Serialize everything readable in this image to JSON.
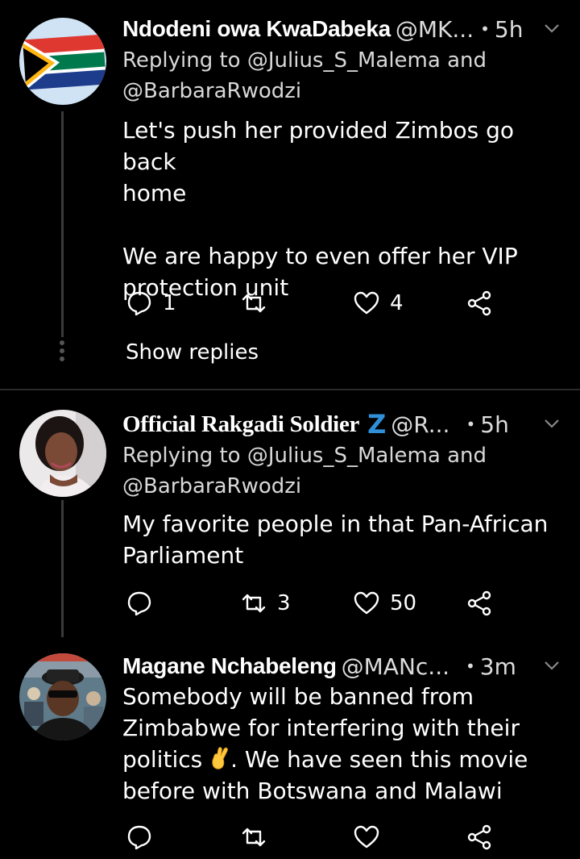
{
  "tweets": [
    {
      "name": "Ndodeni owa KwaDabeka",
      "handle": "@MK...",
      "dot": "•",
      "time": "5h",
      "reply_prefix": "Replying to @Julius_S_Malema and",
      "reply_second": "@BarbaraRwodzi",
      "text": "Let's push her provided Zimbos go back\nhome\n\nWe are happy to even offer her VIP\nprotection unit",
      "reply_count": "1",
      "retweet_count": "",
      "like_count": "4",
      "show_replies": "Show replies",
      "avatar_icon": "south-africa-flag"
    },
    {
      "name": "Official Rakgadi Soldier",
      "badge": "Z",
      "handle": "@R...",
      "dot": "•",
      "time": "5h",
      "reply_prefix": "Replying to @Julius_S_Malema and",
      "reply_second": "@BarbaraRwodzi",
      "text": "My favorite people in that Pan-African\nParliament",
      "reply_count": "",
      "retweet_count": "3",
      "like_count": "50",
      "avatar_icon": "profile-photo"
    },
    {
      "name": "Magane Nchabeleng",
      "handle": "@MANc...",
      "dot": "•",
      "time": "3m",
      "text_part1": "Somebody will be banned from\nZimbabwe for interfering with their\npolitics ",
      "text_part2": ". We have seen this movie\nbefore with Botswana and Malawi",
      "emoji": "crossed-fingers",
      "reply_count": "",
      "retweet_count": "",
      "like_count": "",
      "avatar_icon": "profile-photo"
    }
  ],
  "colors": {
    "background": "#000000",
    "text": "#ffffff",
    "muted": "#dcdcdc",
    "badge_blue": "#2f8fd8"
  }
}
